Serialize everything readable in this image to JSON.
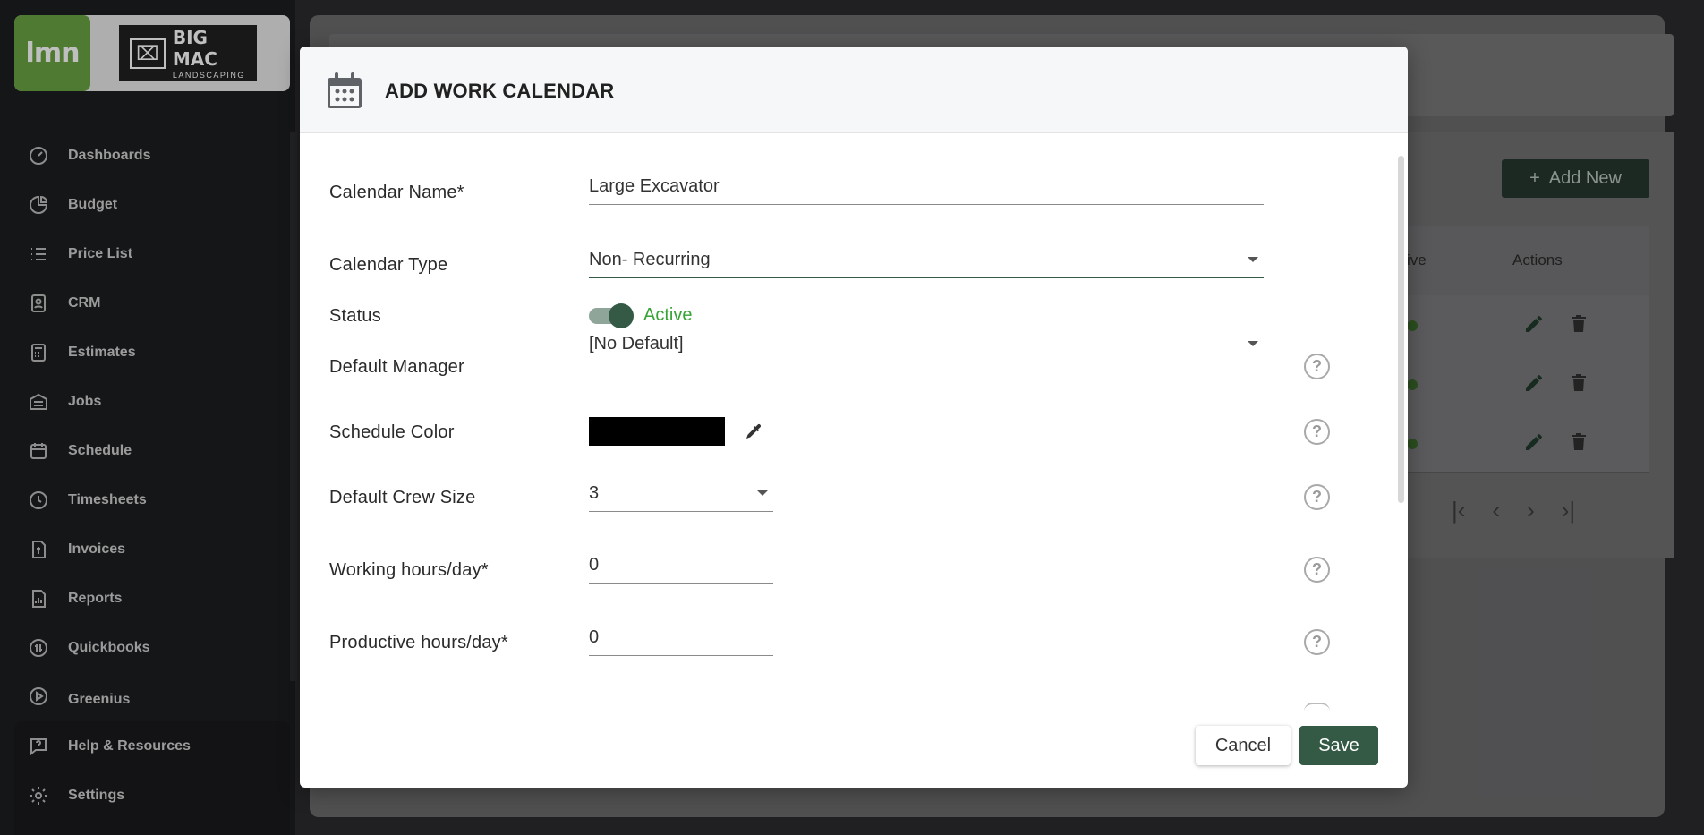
{
  "sidebar": {
    "lmn_logo": "lmn",
    "client_logo": {
      "big": "BIG MAC",
      "sub": "LANDSCAPING"
    },
    "items": [
      {
        "label": "Dashboards",
        "icon": "gauge-icon"
      },
      {
        "label": "Budget",
        "icon": "pie-chart-icon"
      },
      {
        "label": "Price List",
        "icon": "list-icon"
      },
      {
        "label": "CRM",
        "icon": "contact-card-icon"
      },
      {
        "label": "Estimates",
        "icon": "calculator-icon"
      },
      {
        "label": "Jobs",
        "icon": "building-icon"
      },
      {
        "label": "Schedule",
        "icon": "calendar-icon"
      },
      {
        "label": "Timesheets",
        "icon": "clock-icon"
      },
      {
        "label": "Invoices",
        "icon": "invoice-icon"
      },
      {
        "label": "Reports",
        "icon": "report-icon"
      },
      {
        "label": "Quickbooks",
        "icon": "quickbooks-icon"
      },
      {
        "label": "Greenius",
        "icon": "play-circle-icon"
      }
    ],
    "footer_items": [
      {
        "label": "Help & Resources",
        "icon": "help-chat-icon"
      },
      {
        "label": "Settings",
        "icon": "gear-icon"
      }
    ]
  },
  "background": {
    "add_new_label": "Add New",
    "table_headers": {
      "active": "ive",
      "actions": "Actions"
    }
  },
  "modal": {
    "title": "ADD WORK CALENDAR",
    "fields": {
      "calendar_name": {
        "label": "Calendar Name*",
        "value": "Large Excavator"
      },
      "calendar_type": {
        "label": "Calendar Type",
        "value": "Non- Recurring"
      },
      "status": {
        "label": "Status",
        "value": "Active"
      },
      "default_manager": {
        "label": "Default Manager",
        "value": "[No Default]"
      },
      "schedule_color": {
        "label": "Schedule Color",
        "value": "#000000"
      },
      "default_crew_size": {
        "label": "Default Crew Size",
        "value": "3"
      },
      "working_hours": {
        "label": "Working hours/day*",
        "value": "0"
      },
      "productive_hours": {
        "label": "Productive hours/day*",
        "value": "0"
      }
    },
    "buttons": {
      "cancel": "Cancel",
      "save": "Save"
    }
  },
  "colors": {
    "brand_green": "#345a45",
    "lmn_green": "#6aa342",
    "status_active": "#36a336"
  }
}
